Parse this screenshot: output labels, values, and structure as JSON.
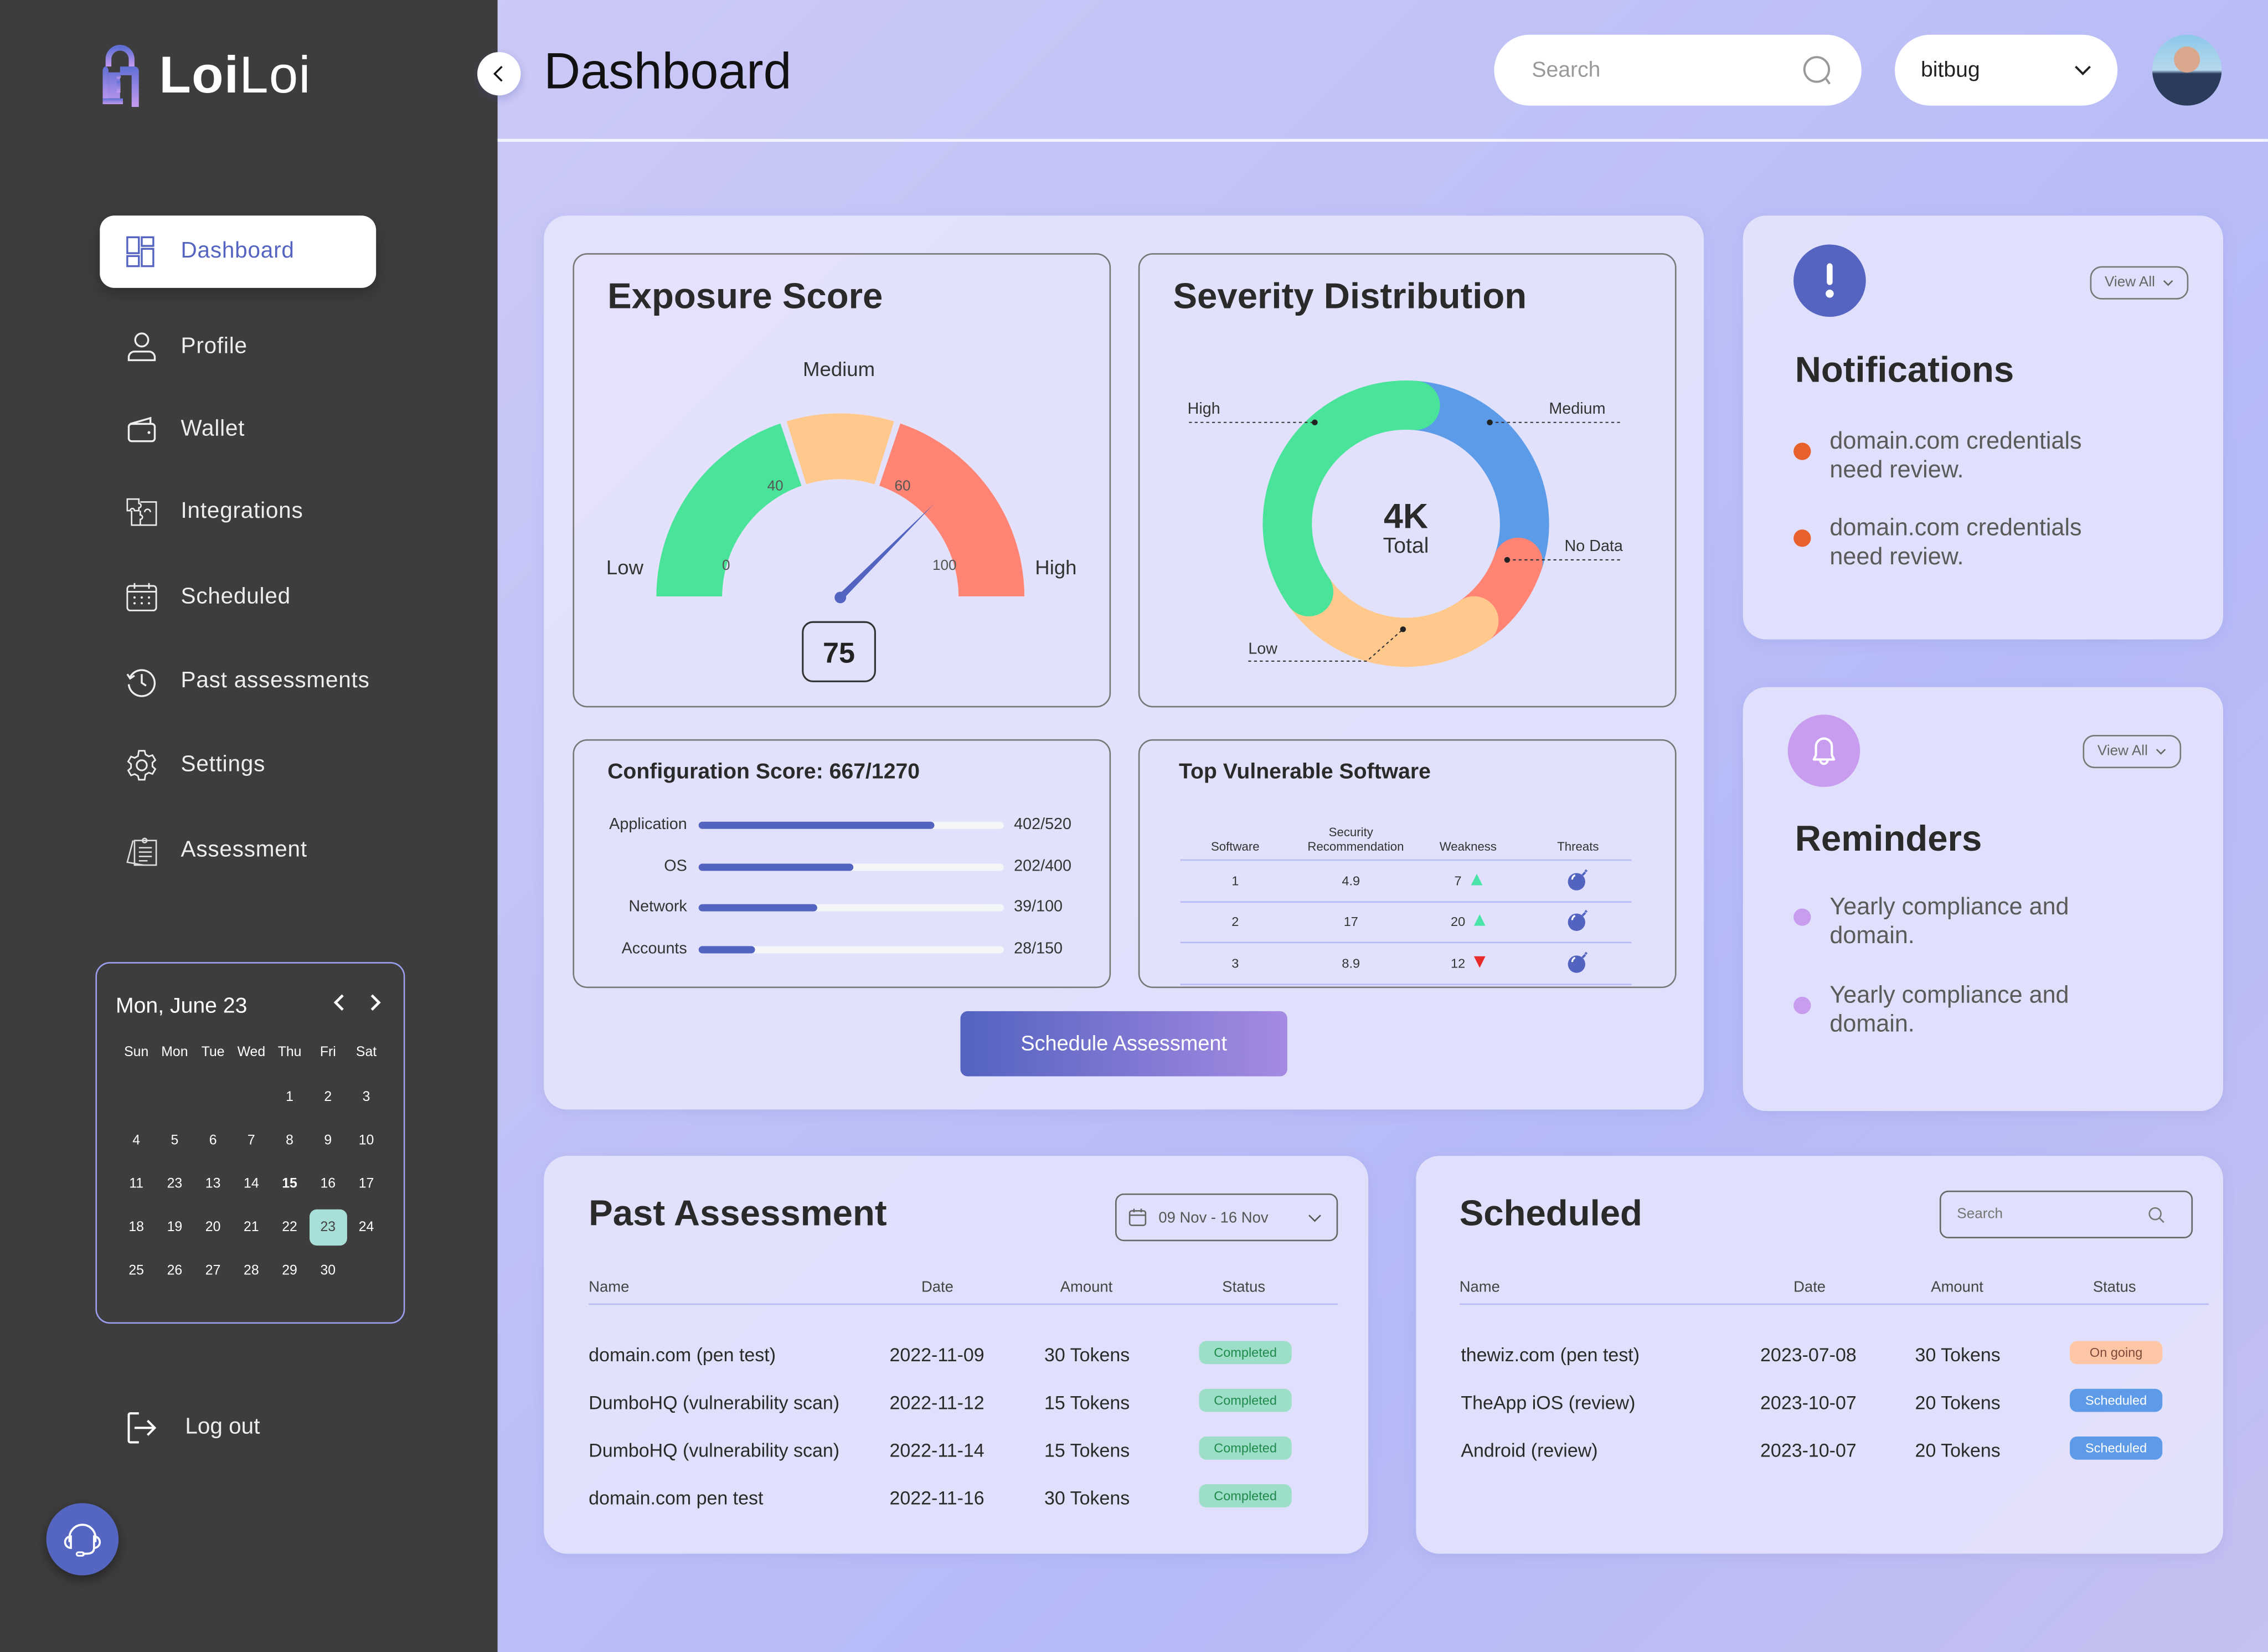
{
  "brand": {
    "name_bold": "Loi",
    "name_light": "Loi"
  },
  "header": {
    "title": "Dashboard",
    "search_placeholder": "Search",
    "org_selected": "bitbug"
  },
  "sidebar": {
    "items": [
      {
        "label": "Dashboard",
        "icon": "dashboard-icon",
        "active": true
      },
      {
        "label": "Profile",
        "icon": "user-icon"
      },
      {
        "label": "Wallet",
        "icon": "wallet-icon"
      },
      {
        "label": "Integrations",
        "icon": "puzzle-icon"
      },
      {
        "label": "Scheduled",
        "icon": "calendar-icon"
      },
      {
        "label": "Past assessments",
        "icon": "history-icon"
      },
      {
        "label": "Settings",
        "icon": "gear-icon"
      },
      {
        "label": "Assessment",
        "icon": "clipboard-icon"
      }
    ],
    "logout_label": "Log out"
  },
  "calendar": {
    "title": "Mon,  June 23",
    "weekdays": [
      "Sun",
      "Mon",
      "Tue",
      "Wed",
      "Thu",
      "Fri",
      "Sat"
    ],
    "weeks": [
      [
        "",
        "",
        "",
        "",
        "1",
        "2",
        "3"
      ],
      [
        "4",
        "5",
        "6",
        "7",
        "8",
        "9",
        "10"
      ],
      [
        "11",
        "23",
        "13",
        "14",
        "15",
        "16",
        "17"
      ],
      [
        "18",
        "19",
        "20",
        "21",
        "22",
        "23",
        "24"
      ],
      [
        "25",
        "26",
        "27",
        "28",
        "29",
        "30",
        ""
      ]
    ],
    "bold_day": "15",
    "selected_day": "23",
    "selected_color": "#a8dfd9"
  },
  "exposure": {
    "title": "Exposure Score",
    "labels": {
      "low": "Low",
      "medium": "Medium",
      "high": "High"
    },
    "ticks": [
      "0",
      "40",
      "60",
      "100"
    ],
    "value": 75,
    "value_label": "75"
  },
  "chart_data": [
    {
      "type": "gauge",
      "title": "Exposure Score",
      "range": [
        0,
        100
      ],
      "bands": [
        {
          "name": "Low",
          "from": 0,
          "to": 40,
          "color": "#4ae39a"
        },
        {
          "name": "Medium",
          "from": 40,
          "to": 60,
          "color": "#ffc98e"
        },
        {
          "name": "High",
          "from": 60,
          "to": 100,
          "color": "#ff8474"
        }
      ],
      "value": 75
    },
    {
      "type": "pie",
      "title": "Severity Distribution",
      "center_value": "4K",
      "center_label": "Total",
      "slices": [
        {
          "label": "Medium",
          "share": 0.29,
          "color": "#5c9be8"
        },
        {
          "label": "No Data",
          "share": 0.1,
          "color": "#ff8474"
        },
        {
          "label": "Low",
          "share": 0.25,
          "color": "#ffc98e"
        },
        {
          "label": "High",
          "share": 0.36,
          "color": "#4ae39a"
        }
      ]
    },
    {
      "type": "bar",
      "title": "Configuration Score: 667/1270",
      "categories": [
        "Application",
        "OS",
        "Network",
        "Accounts"
      ],
      "values": [
        402,
        202,
        39,
        28
      ],
      "max": [
        520,
        400,
        100,
        150
      ],
      "labels": [
        "402/520",
        "202/400",
        "39/100",
        "28/150"
      ]
    }
  ],
  "severity": {
    "title": "Severity Distribution",
    "center_value": "4K",
    "center_label": "Total",
    "labels": {
      "high": "High",
      "medium": "Medium",
      "no_data": "No Data",
      "low": "Low"
    }
  },
  "config": {
    "title": "Configuration Score: 667/1270",
    "rows": [
      {
        "label": "Application",
        "value": 402,
        "max": 520,
        "text": "402/520"
      },
      {
        "label": "OS",
        "value": 202,
        "max": 400,
        "text": "202/400"
      },
      {
        "label": "Network",
        "value": 39,
        "max": 100,
        "text": "39/100"
      },
      {
        "label": "Accounts",
        "value": 28,
        "max": 150,
        "text": "28/150"
      }
    ]
  },
  "vuln": {
    "title": "Top Vulnerable Software",
    "headers": [
      "Software",
      "Security Recommendation",
      "Weakness",
      "Threats"
    ],
    "rows": [
      {
        "software": "1",
        "recommendation": "4.9",
        "weakness": "7",
        "trend": "up"
      },
      {
        "software": "2",
        "recommendation": "17",
        "weakness": "20",
        "trend": "up"
      },
      {
        "software": "3",
        "recommendation": "8.9",
        "weakness": "12",
        "trend": "down"
      }
    ],
    "threat_icon": "bomb-icon",
    "up_color": "#4ae3a8",
    "down_color": "#e82a2a"
  },
  "schedule_button": "Schedule Assessment",
  "notifications": {
    "title": "Notifications",
    "view_all": "View All",
    "items": [
      "domain.com credentials need review.",
      "domain.com credentials need review."
    ],
    "dot_color": "#e8602c"
  },
  "reminders": {
    "title": "Reminders",
    "view_all": "View All",
    "items": [
      "Yearly compliance and domain.",
      "Yearly compliance and domain."
    ],
    "dot_color": "#c89df0"
  },
  "past": {
    "title": "Past Assessment",
    "date_range": "09 Nov - 16 Nov",
    "headers": [
      "Name",
      "Date",
      "Amount",
      "Status"
    ],
    "rows": [
      {
        "name": "domain.com (pen test)",
        "date": "2022-11-09",
        "amount": "30 Tokens",
        "status": "Completed"
      },
      {
        "name": "DumboHQ (vulnerability scan)",
        "date": "2022-11-12",
        "amount": "15 Tokens",
        "status": "Completed"
      },
      {
        "name": "DumboHQ (vulnerability scan)",
        "date": "2022-11-14",
        "amount": "15 Tokens",
        "status": "Completed"
      },
      {
        "name": "domain.com pen test",
        "date": "2022-11-16",
        "amount": "30 Tokens",
        "status": "Completed"
      }
    ]
  },
  "scheduled": {
    "title": "Scheduled",
    "search_placeholder": "Search",
    "headers": [
      "Name",
      "Date",
      "Amount",
      "Status"
    ],
    "rows": [
      {
        "name": "thewiz.com (pen test)",
        "date": "2023-07-08",
        "amount": "30 Tokens",
        "status": "On going"
      },
      {
        "name": "TheApp iOS (review)",
        "date": "2023-10-07",
        "amount": "20 Tokens",
        "status": "Scheduled"
      },
      {
        "name": "Android (review)",
        "date": "2023-10-07",
        "amount": "20 Tokens",
        "status": "Scheduled"
      }
    ]
  }
}
